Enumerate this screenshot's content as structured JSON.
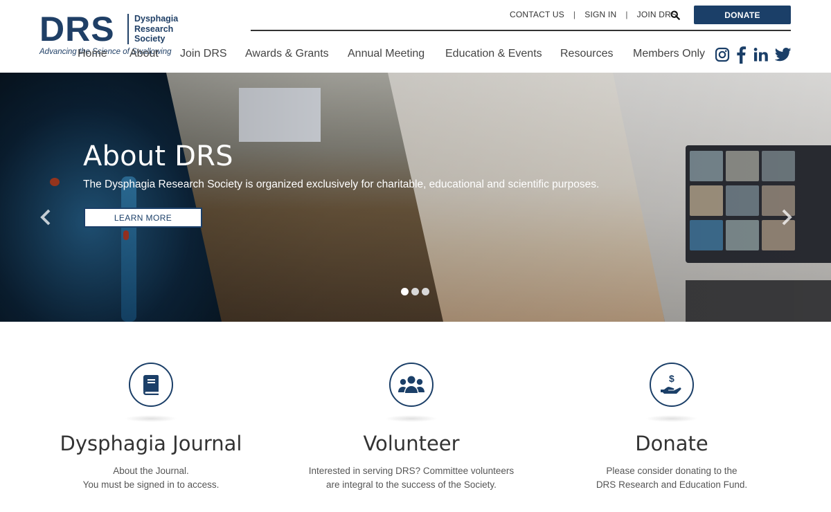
{
  "brand": {
    "logo_text": "DRS",
    "logo_sub": [
      "Dysphagia",
      "Research",
      "Society"
    ],
    "tagline": "Advancing the Science of Swallowing",
    "primary_color": "#1b3f68"
  },
  "utility_nav": {
    "items": [
      "CONTACT US",
      "SIGN IN",
      "JOIN DRS"
    ],
    "separator": "|",
    "search_icon": "search-icon",
    "donate_label": "DONATE"
  },
  "main_nav": {
    "items": [
      "Home",
      "About",
      "Join DRS",
      "Awards & Grants",
      "Annual Meeting",
      "Education & Events",
      "Resources",
      "Members Only"
    ]
  },
  "social": [
    "instagram-icon",
    "facebook-icon",
    "linkedin-icon",
    "twitter-icon"
  ],
  "hero": {
    "title": "About DRS",
    "text": "The Dysphagia Research Society is organized exclusively for charitable, educational and scientific purposes.",
    "button_label": "LEARN MORE",
    "slide_count": 3,
    "active_slide": 1
  },
  "features": [
    {
      "icon": "book-icon",
      "title": "Dysphagia Journal",
      "lines": [
        "About the Journal.",
        "You must be signed in to access."
      ]
    },
    {
      "icon": "people-icon",
      "title": "Volunteer",
      "lines": [
        "Interested in serving DRS? Committee volunteers",
        "are integral to the success of the Society."
      ]
    },
    {
      "icon": "donation-hand-icon",
      "title": "Donate",
      "lines": [
        "Please consider donating to the",
        "DRS Research and Education Fund."
      ]
    }
  ]
}
